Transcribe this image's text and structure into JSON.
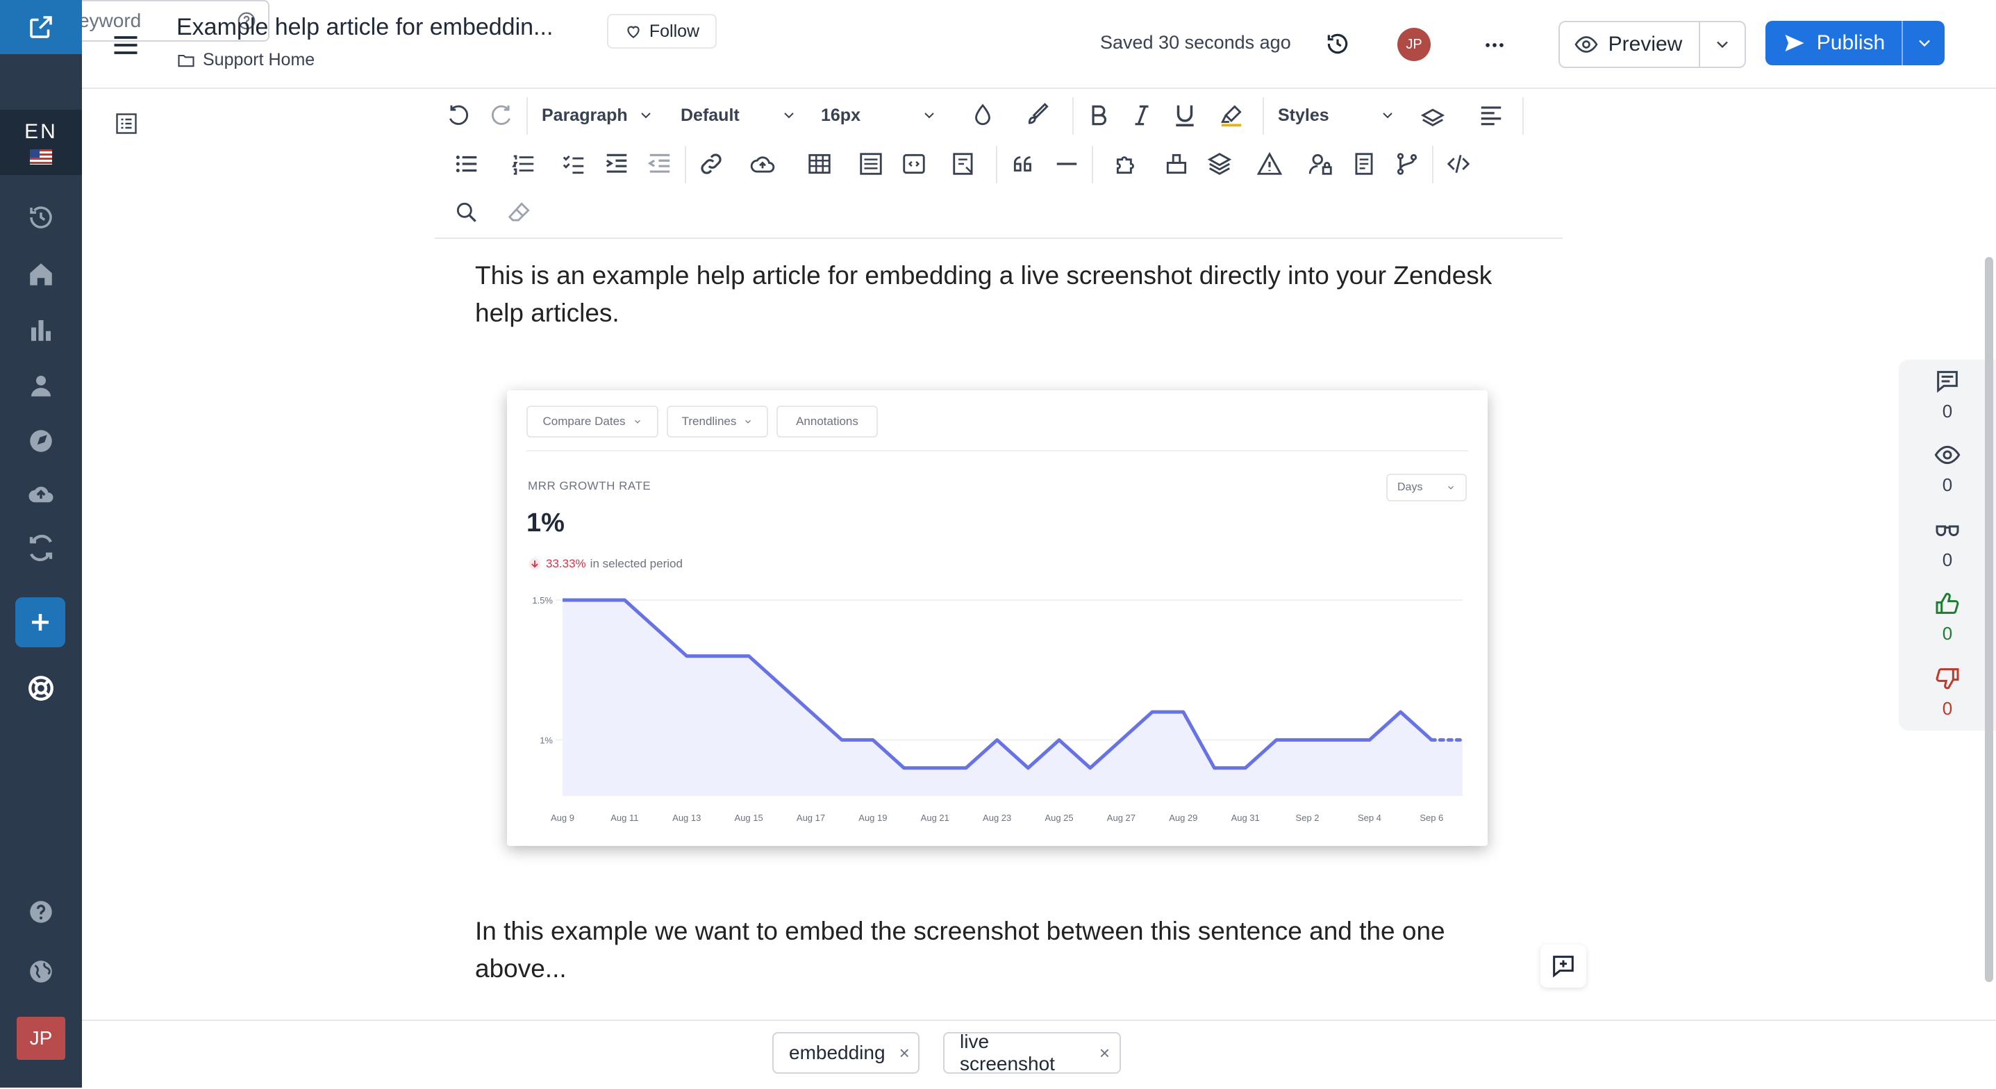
{
  "header": {
    "title": "Example help article for embeddin...",
    "breadcrumb": "Support Home",
    "follow_label": "Follow",
    "saved_status": "Saved 30 seconds ago",
    "user_initials": "JP",
    "preview_label": "Preview",
    "publish_label": "Publish"
  },
  "sidebar": {
    "language": "EN",
    "user_initials": "JP"
  },
  "toolbar": {
    "block_format": "Paragraph",
    "font_family": "Default",
    "font_size": "16px",
    "styles_label": "Styles"
  },
  "content": {
    "paragraph_1": "This is an example help article for embedding a live screenshot directly into your Zendesk help articles.",
    "paragraph_2": "In this example we want to embed the screenshot between this sentence and the one above..."
  },
  "screenshot": {
    "filters": [
      "Compare Dates",
      "Trendlines",
      "Annotations"
    ],
    "metric_name": "MRR GROWTH RATE",
    "metric_value": "1%",
    "change_percent": "33.33%",
    "change_text": "in selected period",
    "period_select": "Days"
  },
  "chart_data": {
    "type": "area",
    "x": [
      "Aug 9",
      "Aug 10",
      "Aug 11",
      "Aug 12",
      "Aug 13",
      "Aug 14",
      "Aug 15",
      "Aug 16",
      "Aug 17",
      "Aug 18",
      "Aug 19",
      "Aug 20",
      "Aug 21",
      "Aug 22",
      "Aug 23",
      "Aug 24",
      "Aug 25",
      "Aug 26",
      "Aug 27",
      "Aug 28",
      "Aug 29",
      "Aug 30",
      "Aug 31",
      "Sep 1",
      "Sep 2",
      "Sep 3",
      "Sep 4",
      "Sep 5",
      "Sep 6",
      "Sep 7"
    ],
    "x_tick_labels": [
      "Aug 9",
      "Aug 11",
      "Aug 13",
      "Aug 15",
      "Aug 17",
      "Aug 19",
      "Aug 21",
      "Aug 23",
      "Aug 25",
      "Aug 27",
      "Aug 29",
      "Aug 31",
      "Sep 2",
      "Sep 4",
      "Sep 6"
    ],
    "series": [
      {
        "values": [
          1.5,
          1.5,
          1.5,
          1.4,
          1.3,
          1.3,
          1.3,
          1.2,
          1.1,
          1.0,
          1.0,
          0.9,
          0.9,
          0.9,
          1.0,
          0.9,
          1.0,
          0.9,
          1.0,
          1.1,
          1.1,
          0.9,
          0.9,
          1.0,
          1.0,
          1.0,
          1.0,
          1.1,
          1.0,
          1.0
        ],
        "color": "#6772e5",
        "dotted_from": "Sep 6"
      }
    ],
    "y_ticks": [
      "1.5%",
      "1%"
    ],
    "ylim": [
      0.8,
      1.5
    ]
  },
  "stats": [
    {
      "icon": "comment-icon",
      "value": "0"
    },
    {
      "icon": "eye-icon",
      "value": "0"
    },
    {
      "icon": "glasses-icon",
      "value": "0"
    },
    {
      "icon": "thumbs-up-icon",
      "value": "0",
      "color": "#1e7d32"
    },
    {
      "icon": "thumbs-down-icon",
      "value": "0",
      "color": "#c0392b"
    }
  ],
  "keywords": {
    "placeholder": "Add a keyword",
    "tags": [
      "embedding",
      "live screenshot"
    ]
  },
  "colors": {
    "rail": "#2b3a4c",
    "brand": "#1f73b7",
    "publish": "#1f73e0",
    "chart_line": "#6772e5"
  }
}
